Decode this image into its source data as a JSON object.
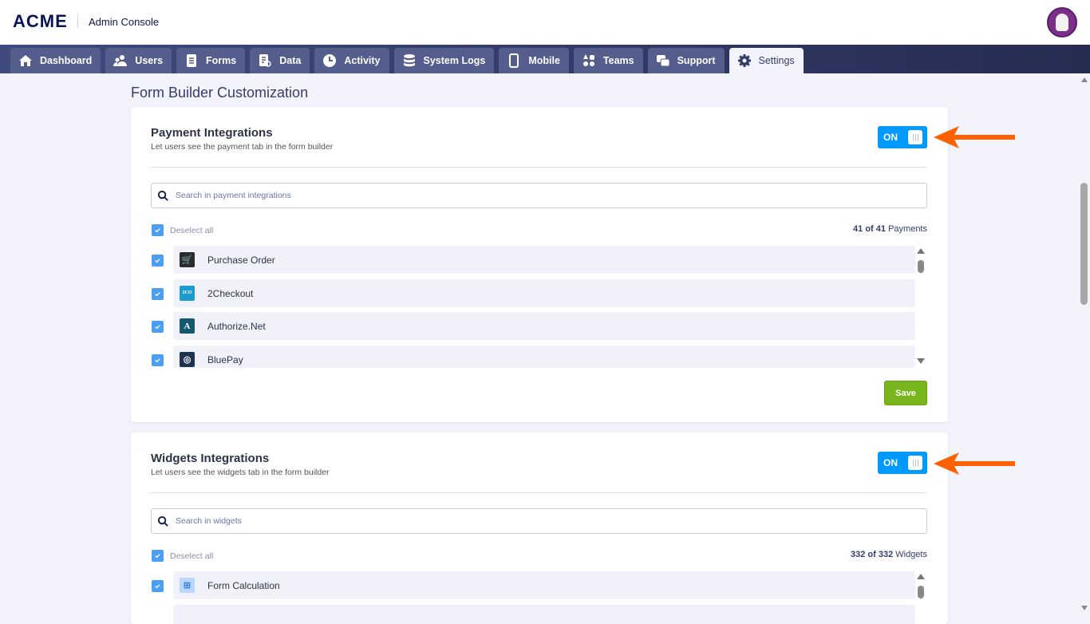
{
  "header": {
    "logo": "ACME",
    "app_title": "Admin Console"
  },
  "nav": {
    "tabs": [
      {
        "label": "Dashboard",
        "icon": "home-icon"
      },
      {
        "label": "Users",
        "icon": "users-icon"
      },
      {
        "label": "Forms",
        "icon": "forms-icon"
      },
      {
        "label": "Data",
        "icon": "data-icon"
      },
      {
        "label": "Activity",
        "icon": "clock-icon"
      },
      {
        "label": "System Logs",
        "icon": "database-icon"
      },
      {
        "label": "Mobile",
        "icon": "mobile-icon"
      },
      {
        "label": "Teams",
        "icon": "teams-icon"
      },
      {
        "label": "Support",
        "icon": "chat-icon"
      },
      {
        "label": "Settings",
        "icon": "gear-icon",
        "active": true
      }
    ]
  },
  "page": {
    "title": "Form Builder Customization"
  },
  "payments": {
    "title": "Payment Integrations",
    "subtitle": "Let users see the payment tab in the form builder",
    "toggle": "ON",
    "search_placeholder": "Search in payment integrations",
    "deselect_label": "Deselect all",
    "count_bold": "41 of 41",
    "count_unit": "Payments",
    "items": [
      {
        "name": "Purchase Order",
        "icon_color": "#2b2b2b",
        "glyph": "🛒"
      },
      {
        "name": "2Checkout",
        "icon_color": "#1b9ccc",
        "glyph": "2CO"
      },
      {
        "name": "Authorize.Net",
        "icon_color": "#145a6e",
        "glyph": "A"
      },
      {
        "name": "BluePay",
        "icon_color": "#1d3350",
        "glyph": "◎"
      }
    ],
    "save_label": "Save"
  },
  "widgets": {
    "title": "Widgets Integrations",
    "subtitle": "Let users see the widgets tab in the form builder",
    "toggle": "ON",
    "search_placeholder": "Search in widgets",
    "deselect_label": "Deselect all",
    "count_bold": "332 of 332",
    "count_unit": "Widgets",
    "items": [
      {
        "name": "Form Calculation",
        "icon_color": "#b9d8ff",
        "glyph": "⊞"
      }
    ]
  },
  "colors": {
    "accent": "#0099ff",
    "save": "#78b51c",
    "arrow": "#ff6100",
    "nav": "#343c6a"
  }
}
